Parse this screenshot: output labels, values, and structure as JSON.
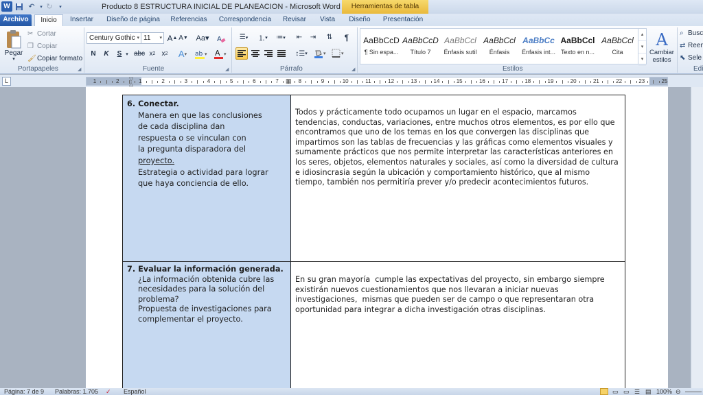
{
  "window": {
    "title": "Producto 8  ESTRUCTURA INICIAL DE PLANEACION  -  Microsoft Word",
    "contextual_tab": "Herramientas de tabla",
    "app_logo": "W"
  },
  "tabs": [
    {
      "label": "Archivo"
    },
    {
      "label": "Inicio"
    },
    {
      "label": "Insertar"
    },
    {
      "label": "Diseño de página"
    },
    {
      "label": "Referencias"
    },
    {
      "label": "Correspondencia"
    },
    {
      "label": "Revisar"
    },
    {
      "label": "Vista"
    },
    {
      "label": "Diseño"
    },
    {
      "label": "Presentación"
    }
  ],
  "ribbon": {
    "clipboard": {
      "paste": "Pegar",
      "cut": "Cortar",
      "copy": "Copiar",
      "format_painter": "Copiar formato",
      "group_label": "Portapapeles"
    },
    "font": {
      "font_name": "Century Gothic",
      "font_size": "11",
      "bold": "N",
      "italic": "K",
      "underline": "S",
      "strike": "abc",
      "group_label": "Fuente"
    },
    "paragraph": {
      "group_label": "Párrafo"
    },
    "styles": {
      "items": [
        {
          "sample": "AaBbCcD",
          "name": "¶ Sin espa..."
        },
        {
          "sample": "AaBbCcD",
          "name": "Título 7"
        },
        {
          "sample": "AaBbCcl",
          "name": "Énfasis sutil"
        },
        {
          "sample": "AaBbCcl",
          "name": "Énfasis"
        },
        {
          "sample": "AaBbCc",
          "name": "Énfasis int..."
        },
        {
          "sample": "AaBbCcl",
          "name": "Texto en n..."
        },
        {
          "sample": "AaBbCcl",
          "name": "Cita"
        }
      ],
      "change_styles": "Cambiar estilos",
      "group_label": "Estilos"
    },
    "editing": {
      "find": "Busc",
      "replace": "Reen",
      "select": "Sele",
      "group_label": "Edi"
    }
  },
  "ruler": {
    "numbers": [
      "1",
      "2",
      "1",
      "2",
      "3",
      "4",
      "5",
      "6",
      "7",
      "8",
      "9",
      "10",
      "11",
      "12",
      "13",
      "14",
      "15",
      "16",
      "17",
      "18",
      "19",
      "20",
      "21",
      "22",
      "23",
      "25"
    ],
    "corner": "L"
  },
  "document": {
    "row6": {
      "heading": "6. Conectar.",
      "left_lines": [
        "Manera en que las conclusiones",
        "de cada disciplina dan",
        "respuesta  o se vinculan con",
        "la pregunta  disparadora del",
        "proyecto.",
        "Estrategia o  actividad para lograr",
        "que haya   conciencia de ello."
      ],
      "right": "Todos y prácticamente todo ocupamos un lugar en el espacio, marcamos tendencias, conductas, variaciones, entre muchos otros elementos, es por ello que encontramos que uno de los temas en los que convergen las disciplinas que impartimos son las tablas de frecuencias y las gráficas como elementos visuales y sumamente prácticos que nos permite interpretar las características anteriores en los seres, objetos, elementos naturales y sociales, así como la diversidad de cultura e idiosincrasia según la ubicación y comportamiento histórico, que al mismo tiempo, también nos permitiría prever y/o predecir acontecimientos futuros."
    },
    "row7": {
      "heading": "7.  Evaluar la información generada.",
      "left_lines": [
        "¿La información obtenida cubre las",
        "necesidades para la solución del",
        "problema?",
        "Propuesta de investigaciones para",
        "complementar el proyecto."
      ],
      "right": "En su gran mayoría  cumple las expectativas del proyecto, sin embargo siempre existirán nuevos cuestionamientos que nos llevaran a iniciar nuevas investigaciones,  mismas que pueden ser de campo o que representaran otra oportunidad para integrar a dicha investigación otras disciplinas."
    }
  },
  "statusbar": {
    "page": "Página: 7 de 9",
    "words": "Palabras: 1.705",
    "language": "Español",
    "zoom": "100%"
  }
}
